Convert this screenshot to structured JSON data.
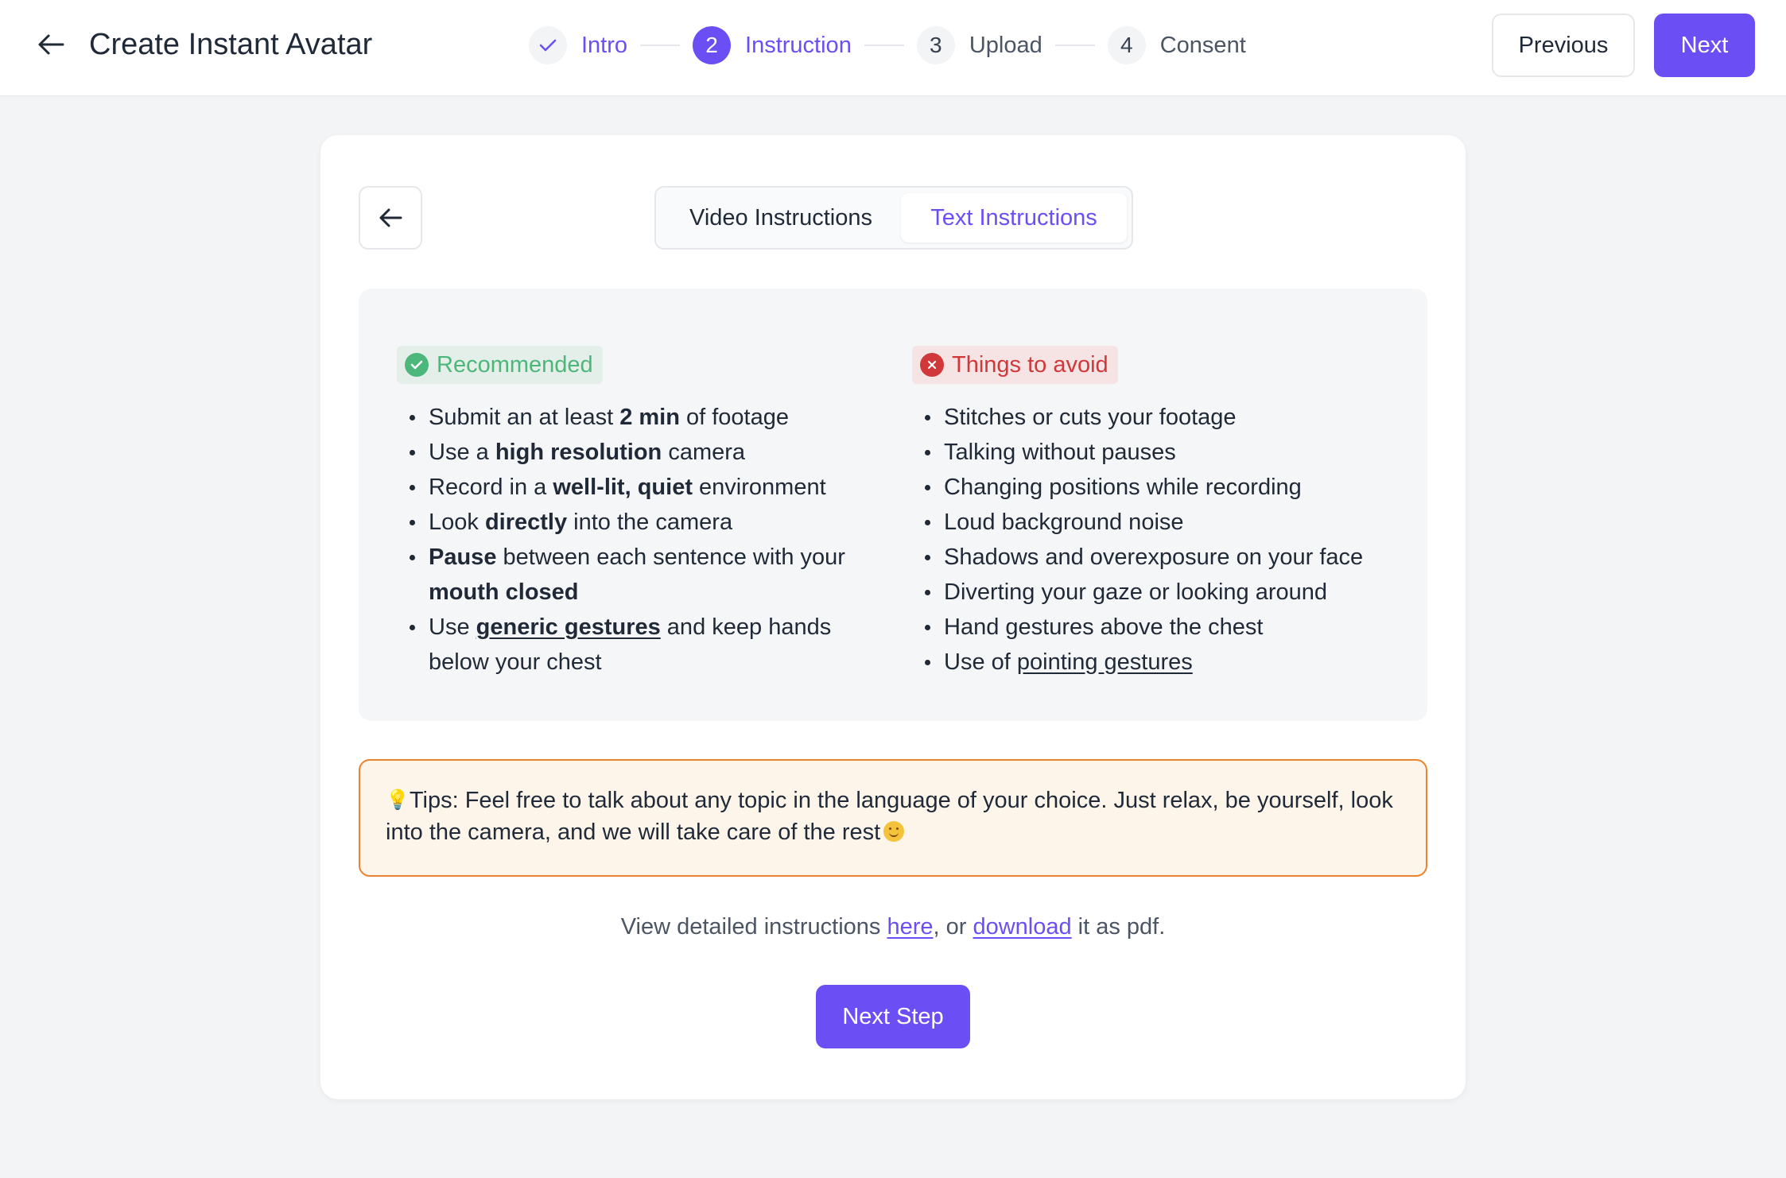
{
  "header": {
    "title": "Create Instant Avatar",
    "stepper": [
      {
        "number": "",
        "label": "Intro",
        "state": "done"
      },
      {
        "number": "2",
        "label": "Instruction",
        "state": "active"
      },
      {
        "number": "3",
        "label": "Upload",
        "state": "pending"
      },
      {
        "number": "4",
        "label": "Consent",
        "state": "pending"
      }
    ],
    "previous_label": "Previous",
    "next_label": "Next"
  },
  "tabs": {
    "video": "Video Instructions",
    "text": "Text Instructions",
    "active": "text"
  },
  "recommended": {
    "title": "Recommended",
    "items": [
      [
        {
          "t": "Submit an at least "
        },
        {
          "t": "2 min",
          "b": true
        },
        {
          "t": " of footage"
        }
      ],
      [
        {
          "t": "Use a "
        },
        {
          "t": "high resolution",
          "b": true
        },
        {
          "t": " camera"
        }
      ],
      [
        {
          "t": "Record in a "
        },
        {
          "t": "well-lit, quiet",
          "b": true
        },
        {
          "t": " environment"
        }
      ],
      [
        {
          "t": "Look "
        },
        {
          "t": "directly",
          "b": true
        },
        {
          "t": " into the camera"
        }
      ],
      [
        {
          "t": "Pause",
          "b": true
        },
        {
          "t": " between each sentence with your "
        },
        {
          "t": "mouth closed",
          "b": true
        }
      ],
      [
        {
          "t": "Use "
        },
        {
          "t": "generic gestures",
          "b": true,
          "u": true
        },
        {
          "t": " and keep hands below your chest"
        }
      ]
    ]
  },
  "avoid": {
    "title": "Things to avoid",
    "items": [
      [
        {
          "t": "Stitches or cuts your footage"
        }
      ],
      [
        {
          "t": "Talking without pauses"
        }
      ],
      [
        {
          "t": "Changing positions while recording"
        }
      ],
      [
        {
          "t": "Loud background noise"
        }
      ],
      [
        {
          "t": "Shadows and overexposure on your face"
        }
      ],
      [
        {
          "t": "Diverting your gaze or looking around"
        }
      ],
      [
        {
          "t": "Hand gestures above the chest"
        }
      ],
      [
        {
          "t": "Use of "
        },
        {
          "t": "pointing gestures",
          "u": true
        }
      ]
    ]
  },
  "tips": {
    "text": "Tips: Feel free to talk about any topic in the language of your choice. Just relax, be yourself, look into the camera, and we will take care of the rest"
  },
  "footer": {
    "prefix": "View detailed instructions ",
    "here_link": "here",
    "middle": ", or ",
    "download_link": "download",
    "suffix": " it as pdf.",
    "next_step_label": "Next Step"
  },
  "colors": {
    "accent": "#6c4ef5",
    "recommended": "#4cb77a",
    "avoid": "#d0383a",
    "tips_border": "#e9832e"
  }
}
